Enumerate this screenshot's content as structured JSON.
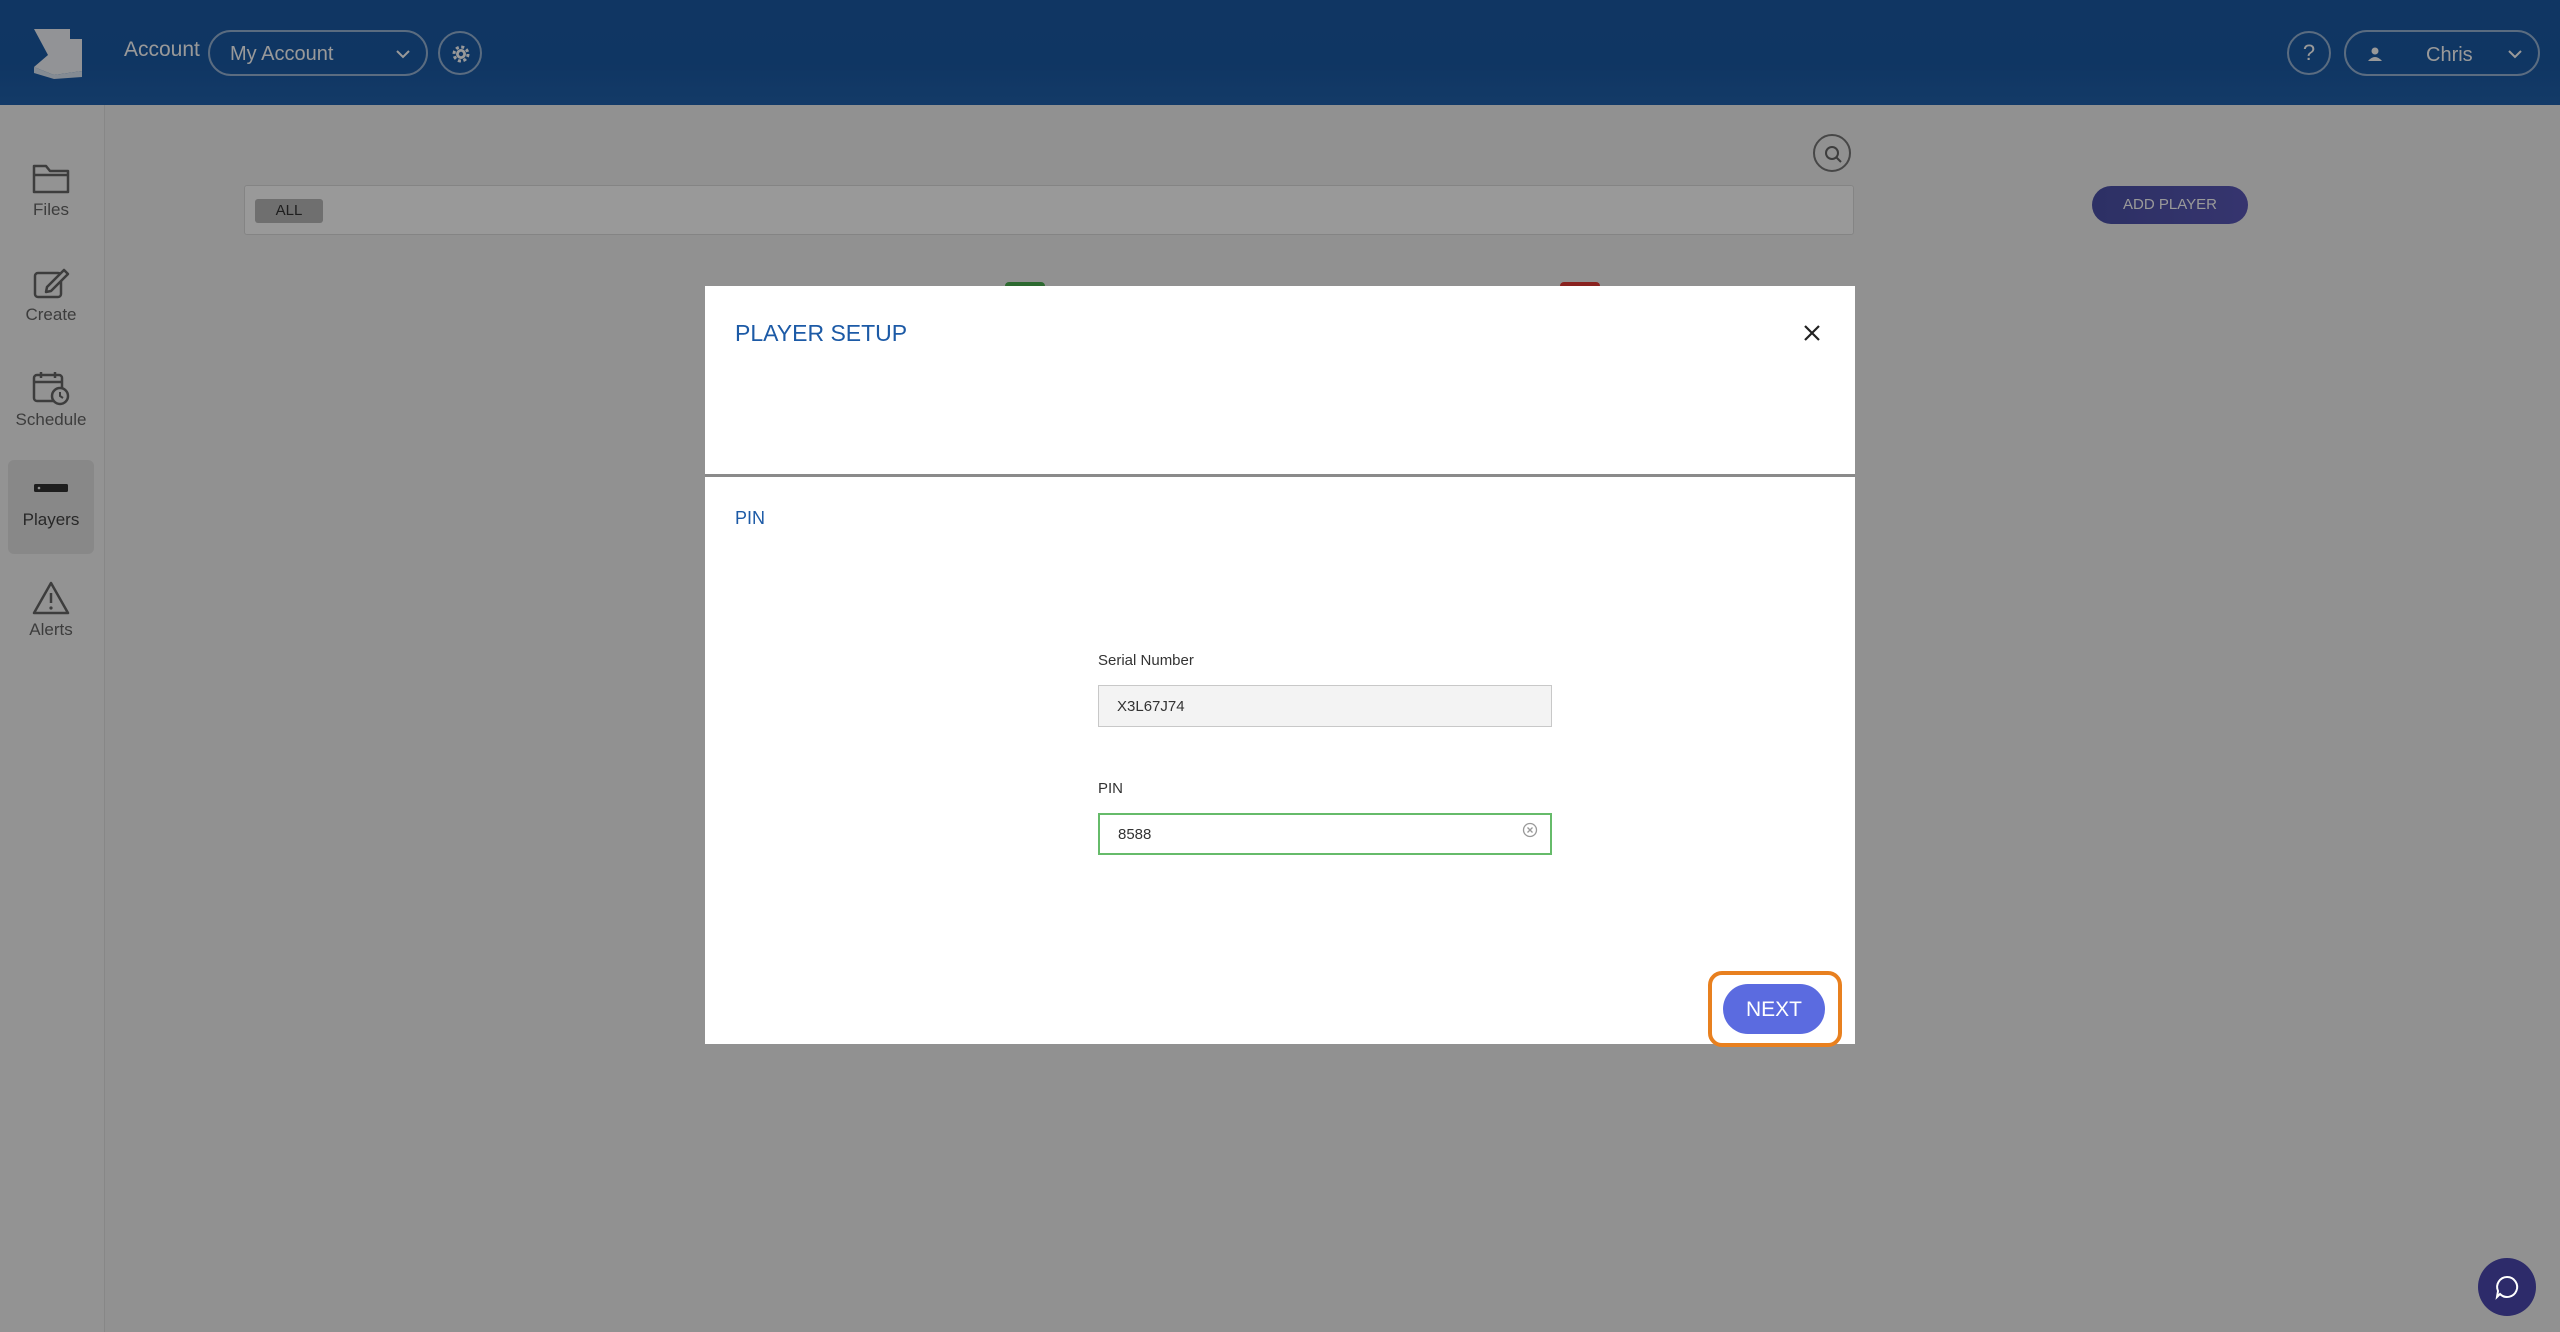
{
  "header": {
    "account_label": "Account",
    "account_select_value": "My Account",
    "help_label": "?",
    "user_name": "Chris"
  },
  "sidebar": {
    "items": [
      {
        "label": "Files",
        "icon": "folder-icon"
      },
      {
        "label": "Create",
        "icon": "edit-icon"
      },
      {
        "label": "Schedule",
        "icon": "calendar-clock-icon"
      },
      {
        "label": "Players",
        "icon": "player-device-icon",
        "active": true
      },
      {
        "label": "Alerts",
        "icon": "warning-icon"
      }
    ]
  },
  "toolbar": {
    "filter_chip": "ALL",
    "add_player_label": "ADD PLAYER"
  },
  "modal": {
    "title": "PLAYER SETUP",
    "step_label": "PIN",
    "serial": {
      "label": "Serial Number",
      "value": "X3L67J74"
    },
    "pin": {
      "label": "PIN",
      "value": "8588"
    },
    "next_label": "NEXT"
  },
  "colors": {
    "header": "#1b5ba6",
    "accent_blue": "#1c5aa6",
    "next_button": "#5b6be0",
    "highlight": "#e8801f",
    "focus_border": "#66bb6a"
  }
}
